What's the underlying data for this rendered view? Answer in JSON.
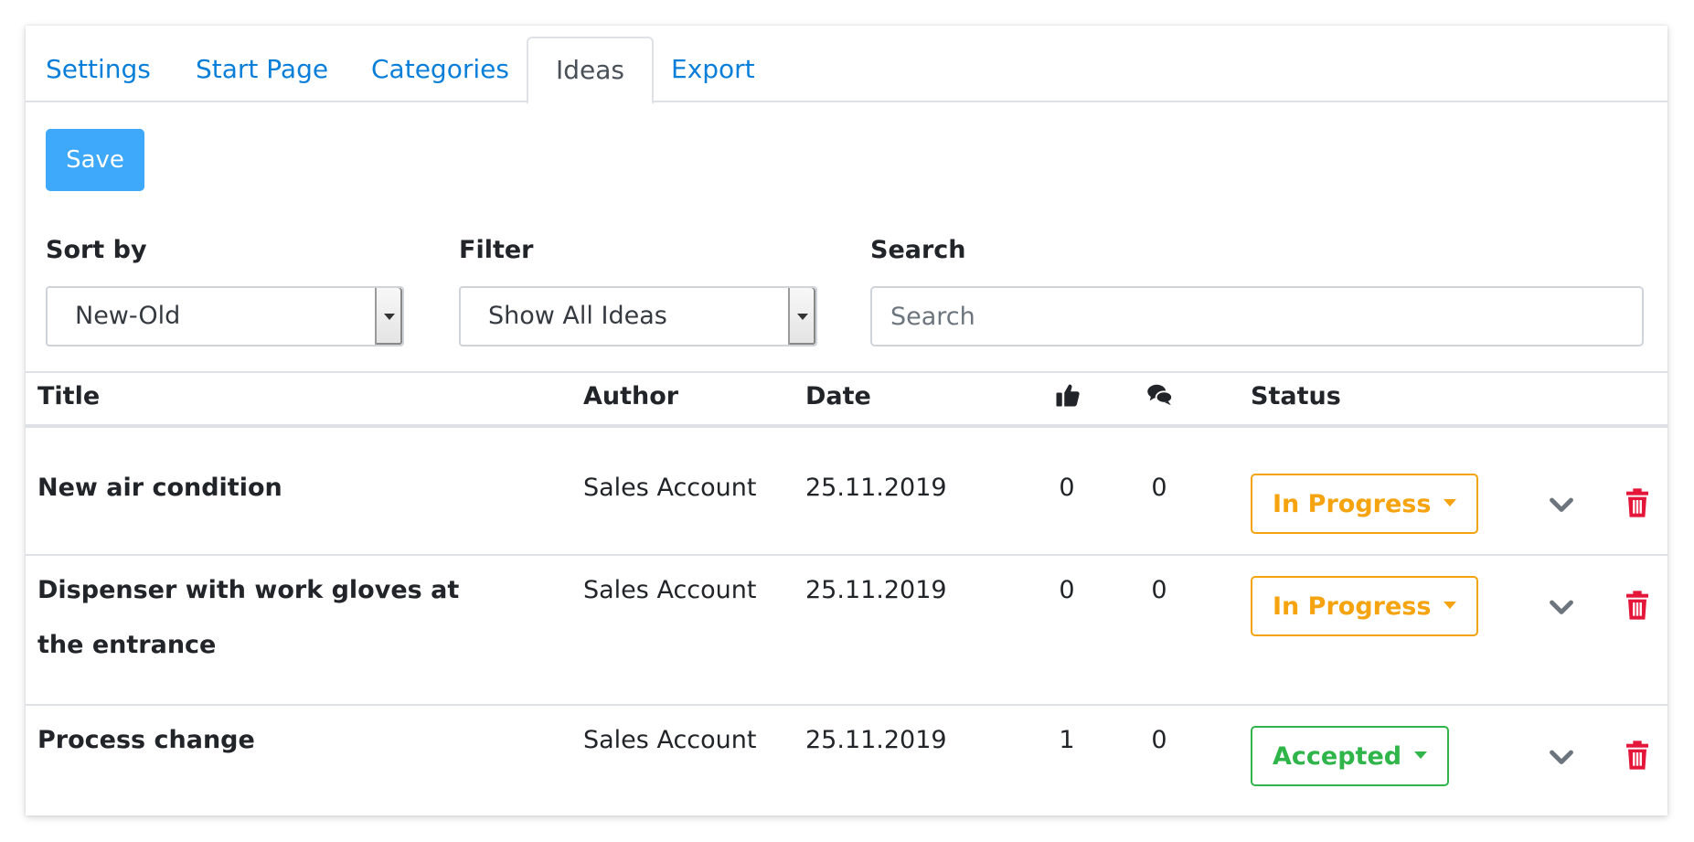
{
  "tabs": [
    {
      "label": "Settings"
    },
    {
      "label": "Start Page"
    },
    {
      "label": "Categories"
    },
    {
      "label": "Ideas"
    },
    {
      "label": "Export"
    }
  ],
  "save_label": "Save",
  "controls": {
    "sort_label": "Sort by",
    "sort_value": "New-Old",
    "filter_label": "Filter",
    "filter_value": "Show All Ideas",
    "search_label": "Search",
    "search_placeholder": "Search"
  },
  "table": {
    "headers": {
      "title": "Title",
      "author": "Author",
      "date": "Date",
      "status": "Status"
    },
    "rows": [
      {
        "title": "New air condition",
        "author": "Sales Account",
        "date": "25.11.2019",
        "likes": "0",
        "comments": "0",
        "status": "In Progress"
      },
      {
        "title": "Dispenser with work gloves at the entrance",
        "author": "Sales Account",
        "date": "25.11.2019",
        "likes": "0",
        "comments": "0",
        "status": "In Progress"
      },
      {
        "title": "Process change",
        "author": "Sales Account",
        "date": "25.11.2019",
        "likes": "1",
        "comments": "0",
        "status": "Accepted"
      }
    ]
  },
  "colors": {
    "link": "#0a7fd9",
    "primary": "#3ea8fb",
    "in_progress": "#f5a30f",
    "accepted": "#2fb54a",
    "delete": "#e4163a"
  },
  "icons": {
    "likes_header": "thumbs-up-icon",
    "comments_header": "comments-icon",
    "expand": "chevron-down-icon",
    "delete": "trash-icon"
  }
}
